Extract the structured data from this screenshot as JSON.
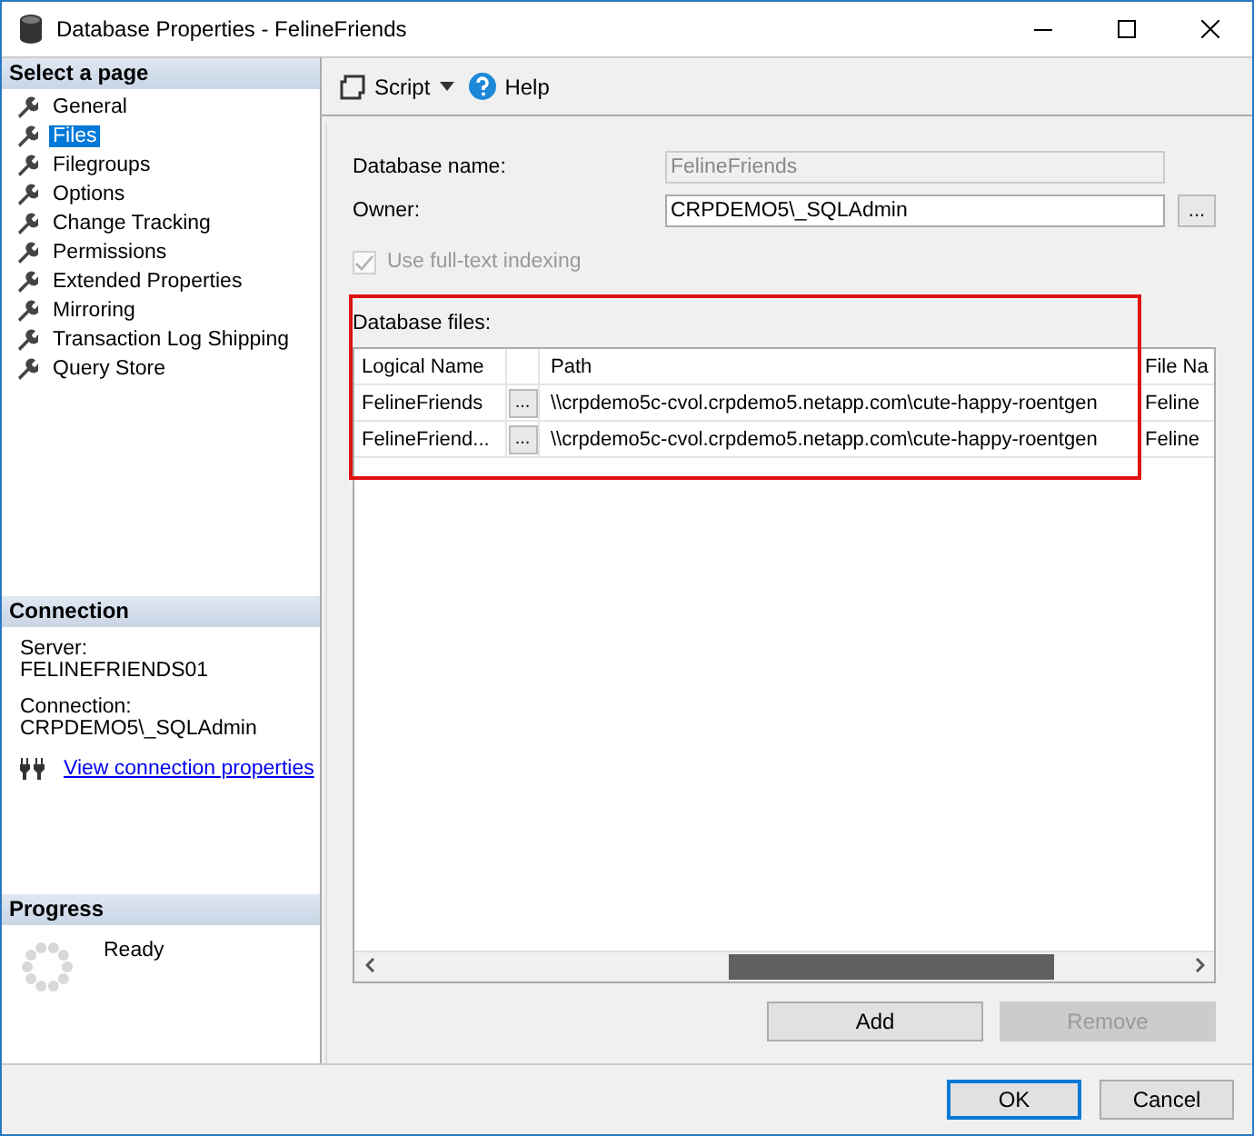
{
  "window": {
    "title": "Database Properties - FelineFriends"
  },
  "sidebar": {
    "header": "Select a page",
    "items": [
      {
        "label": "General",
        "selected": false
      },
      {
        "label": "Files",
        "selected": true
      },
      {
        "label": "Filegroups",
        "selected": false
      },
      {
        "label": "Options",
        "selected": false
      },
      {
        "label": "Change Tracking",
        "selected": false
      },
      {
        "label": "Permissions",
        "selected": false
      },
      {
        "label": "Extended Properties",
        "selected": false
      },
      {
        "label": "Mirroring",
        "selected": false
      },
      {
        "label": "Transaction Log Shipping",
        "selected": false
      },
      {
        "label": "Query Store",
        "selected": false
      }
    ]
  },
  "connection": {
    "header": "Connection",
    "server_label": "Server:",
    "server": "FELINEFRIENDS01",
    "connection_label": "Connection:",
    "connection": "CRPDEMO5\\_SQLAdmin",
    "link": "View connection properties"
  },
  "progress": {
    "header": "Progress",
    "status": "Ready"
  },
  "toolbar": {
    "script": "Script",
    "help": "Help"
  },
  "form": {
    "database_name_label": "Database name:",
    "database_name": "FelineFriends",
    "database_name_disabled": true,
    "owner_label": "Owner:",
    "owner": "CRPDEMO5\\_SQLAdmin",
    "owner_browse": "...",
    "fulltext": {
      "label": "Use full-text indexing",
      "checked": true,
      "disabled": true
    }
  },
  "files": {
    "label": "Database files:",
    "columns": [
      "Logical Name",
      "",
      "Path",
      "File Na"
    ],
    "rows": [
      {
        "logical_name": "FelineFriends",
        "browse": "...",
        "path": "\\\\crpdemo5c-cvol.crpdemo5.netapp.com\\cute-happy-roentgen",
        "file_name": "Feline"
      },
      {
        "logical_name": "FelineFriend...",
        "browse": "...",
        "path": "\\\\crpdemo5c-cvol.crpdemo5.netapp.com\\cute-happy-roentgen",
        "file_name": "Feline"
      }
    ],
    "highlighted": true
  },
  "buttons": [
    {
      "label": "Add",
      "disabled": false
    },
    {
      "label": "Remove",
      "disabled": true
    }
  ],
  "footer": [
    {
      "label": "OK",
      "default": true
    },
    {
      "label": "Cancel",
      "default": false
    }
  ]
}
